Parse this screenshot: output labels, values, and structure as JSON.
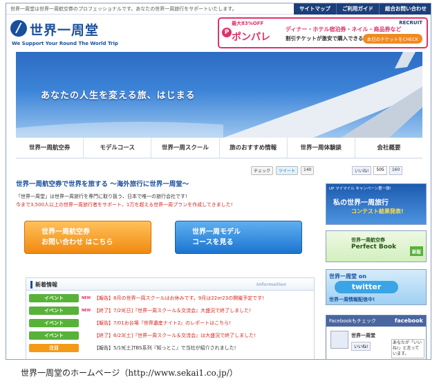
{
  "header": {
    "tagline": "世界一周堂は世界一周航空券のプロフェッショナルです。あなたの世界一周旅行をサポートいたします。",
    "nav": [
      "サイトマップ",
      "ご利用ガイド",
      "総合お問い合わせ"
    ],
    "logo_text": "世界一周堂",
    "logo_sub": "We Support Your Round The World Trip"
  },
  "ad": {
    "badge": "最大83%OFF",
    "name": "ポンパレ",
    "line1": "ディナー・ホテル宿泊券・ネイル・商品券など",
    "line2": "割引チケットが激安で購入できる!",
    "recruit": "RECRUIT",
    "button": "本日のチケットをCHECK"
  },
  "hero": {
    "text": "あなたの人生を変える旅、はじまる"
  },
  "menu": [
    "世界一周航空券",
    "モデルコース",
    "世界一周スクール",
    "旅のおすすめ情報",
    "世界一周体験談",
    "会社概要"
  ],
  "social": {
    "check": "チェック",
    "tweet": "ツイート",
    "tweet_count": "140"
  },
  "main": {
    "headline": "世界一周航空券で世界を旅する 〜海外旅行に世界一周堂〜",
    "intro1": "「世界一周堂」は世界一周旅行を専門に取り扱う、日本で唯一の旅行会社です!",
    "intro2": "今まで3,500人以上の世界一周旅行者をサポート、1万を超える世界一周プランを作成してきました!",
    "btn_inquiry": [
      "世界一周航空券",
      "お問い合わせ はこちら"
    ],
    "btn_model": [
      "世界一周モデル",
      "コースを見る"
    ]
  },
  "news": {
    "title": "新着情報",
    "info": "Information",
    "new_label": "NEW",
    "items": [
      {
        "cat": "イベント",
        "new": true,
        "text": "【報告】8月の世界一周スクールはお休みです。9月は22or23の開催予定です!",
        "red": true
      },
      {
        "cat": "イベント",
        "new": true,
        "text": "【終了】7/29[日]『世界一周スクール＆交流会』大盛況で終了しました!",
        "red": true
      },
      {
        "cat": "イベント",
        "new": false,
        "text": "【報告】7/01お台場『世界遺産ナイト2』のレポートはこちら!",
        "red": true
      },
      {
        "cat": "イベント",
        "new": false,
        "text": "【終了】6/23[土]『世界一周スクール＆交流会』は大盛況で終了しました!",
        "red": true
      },
      {
        "cat": "注目",
        "new": false,
        "text": "【報告】5/19[土]TBS系列『知っとこ』で当社が紹介されました!",
        "red": false
      }
    ]
  },
  "sidebar": {
    "like": "いいね!",
    "like_count": "505",
    "share_count": "160",
    "b1_small": "UP マイマイル キャンペーン第一弾!",
    "b1_main": "私の世界一周旅行",
    "b1_sub": "コンテスト結果発表!",
    "b2_small": "世界一周航空券",
    "b2_main": "Perfect Book",
    "b2_tag": "新版",
    "b3_top": "世界一周堂 on",
    "b3_logo": "twitter",
    "b3_bottom": "世界一周情報配信中!",
    "fb_title": "Facebookもチェック",
    "fb_logo": "facebook",
    "fb_name": "世界一周堂",
    "fb_like": "いいね!",
    "fb_bubble": "あなたが「いいね!」と言っています。"
  },
  "caption": "世界一周堂のホームページ（http://www.sekai1.co.jp/）"
}
